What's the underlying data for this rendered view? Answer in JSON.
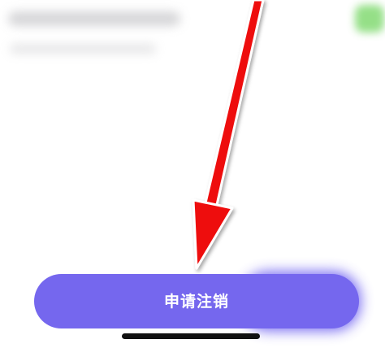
{
  "button": {
    "label": "申请注销"
  },
  "colors": {
    "button_bg": "#7567ee",
    "arrow": "#ee1111",
    "accent_green": "#7bd86a"
  },
  "icons": {
    "overlay": "annotation-arrow-icon"
  }
}
